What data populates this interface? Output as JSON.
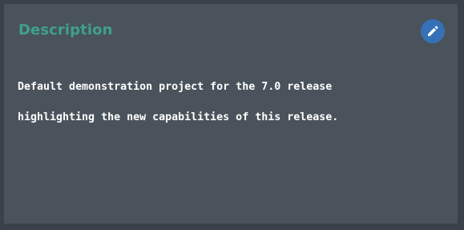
{
  "card": {
    "title": "Description",
    "description_line_1": "Default demonstration project for the 7.0 release",
    "description_line_2": "highlighting the new capabilities of this release.",
    "edit_icon": "pencil-icon"
  },
  "colors": {
    "page_background": "#3a4149",
    "card_background": "#4a535b",
    "title": "#3fa08a",
    "edit_button": "#3671b8",
    "text": "#ffffff"
  }
}
